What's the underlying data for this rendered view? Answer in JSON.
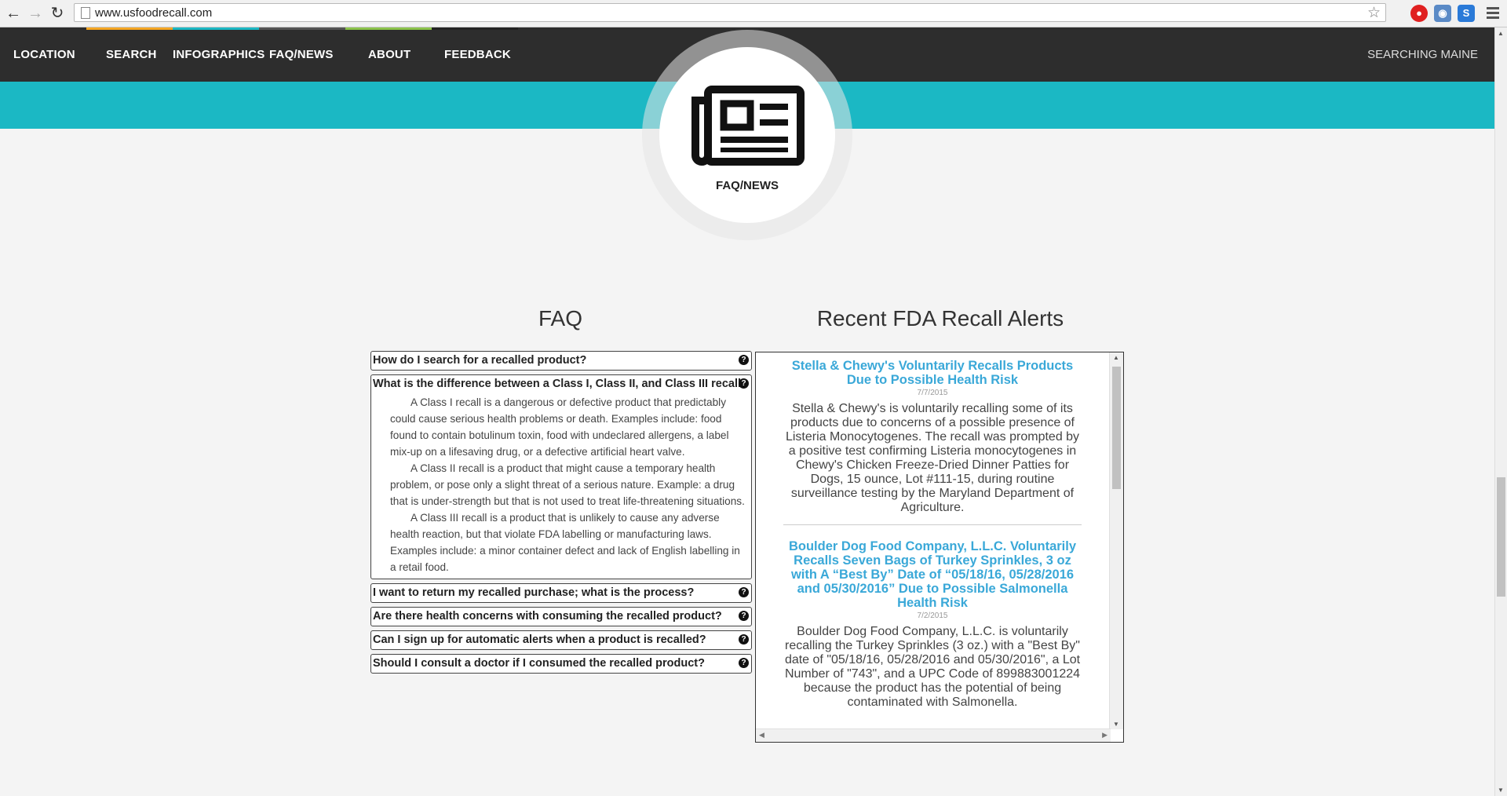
{
  "browser": {
    "url": "www.usfoodrecall.com"
  },
  "nav": {
    "items": [
      {
        "label": "LOCATION",
        "accent": ""
      },
      {
        "label": "SEARCH",
        "accent": "#f5a623"
      },
      {
        "label": "INFOGRAPHICS",
        "accent": "#1bb8c4"
      },
      {
        "label": "FAQ/NEWS",
        "accent": "#555555"
      },
      {
        "label": "ABOUT",
        "accent": "#8bc34a"
      },
      {
        "label": "FEEDBACK",
        "accent": "#222222"
      }
    ],
    "searching": "SEARCHING MAINE"
  },
  "badge": {
    "label": "FAQ/NEWS",
    "icon": "newspaper-icon"
  },
  "faq": {
    "heading": "FAQ",
    "items": [
      {
        "question": "How do I search for a recalled product?"
      },
      {
        "question": "What is the difference between a Class I, Class II, and Class III recall?",
        "answers": [
          "A Class I recall is a dangerous or defective product that predictably could cause serious health problems or death. Examples include: food found to contain botulinum toxin, food with undeclared allergens, a label mix-up on a lifesaving drug, or a defective artificial heart valve.",
          "A Class II recall is a product that might cause a temporary health problem, or pose only a slight threat of a serious nature. Example: a drug that is under-strength but that is not used to treat life-threatening situations.",
          "A Class III recall is a product that is unlikely to cause any adverse health reaction, but that violate FDA labelling or manufacturing laws. Examples include: a minor container defect and lack of English labelling in a retail food."
        ]
      },
      {
        "question": "I want to return my recalled purchase; what is the process?"
      },
      {
        "question": "Are there health concerns with consuming the recalled product?"
      },
      {
        "question": "Can I sign up for automatic alerts when a product is recalled?"
      },
      {
        "question": "Should I consult a doctor if I consumed the recalled product?"
      }
    ],
    "question_icon": "?"
  },
  "recalls": {
    "heading": "Recent FDA Recall Alerts",
    "entries": [
      {
        "title": "Stella & Chewy's Voluntarily Recalls Products Due to Possible Health Risk",
        "date": "7/7/2015",
        "body": "Stella & Chewy's is voluntarily recalling some of its products due to concerns of a possible presence of Listeria Monocytogenes. The recall was prompted by a positive test confirming Listeria monocytogenes in Chewy's Chicken Freeze-Dried Dinner Patties for Dogs, 15 ounce, Lot #111-15, during routine surveillance testing by the Maryland Department of Agriculture."
      },
      {
        "title": "Boulder Dog Food Company, L.L.C. Voluntarily Recalls Seven Bags of Turkey Sprinkles, 3 oz with A “Best By” Date of “05/18/16, 05/28/2016 and 05/30/2016” Due to Possible Salmonella Health Risk",
        "date": "7/2/2015",
        "body": "Boulder Dog Food Company, L.L.C. is voluntarily recalling the Turkey Sprinkles (3 oz.) with a \"Best By\" date of \"05/18/16, 05/28/2016 and 05/30/2016\", a Lot Number of \"743\", and a UPC Code of 899883001224 because the product has the potential of being contaminated with Salmonella."
      }
    ]
  }
}
